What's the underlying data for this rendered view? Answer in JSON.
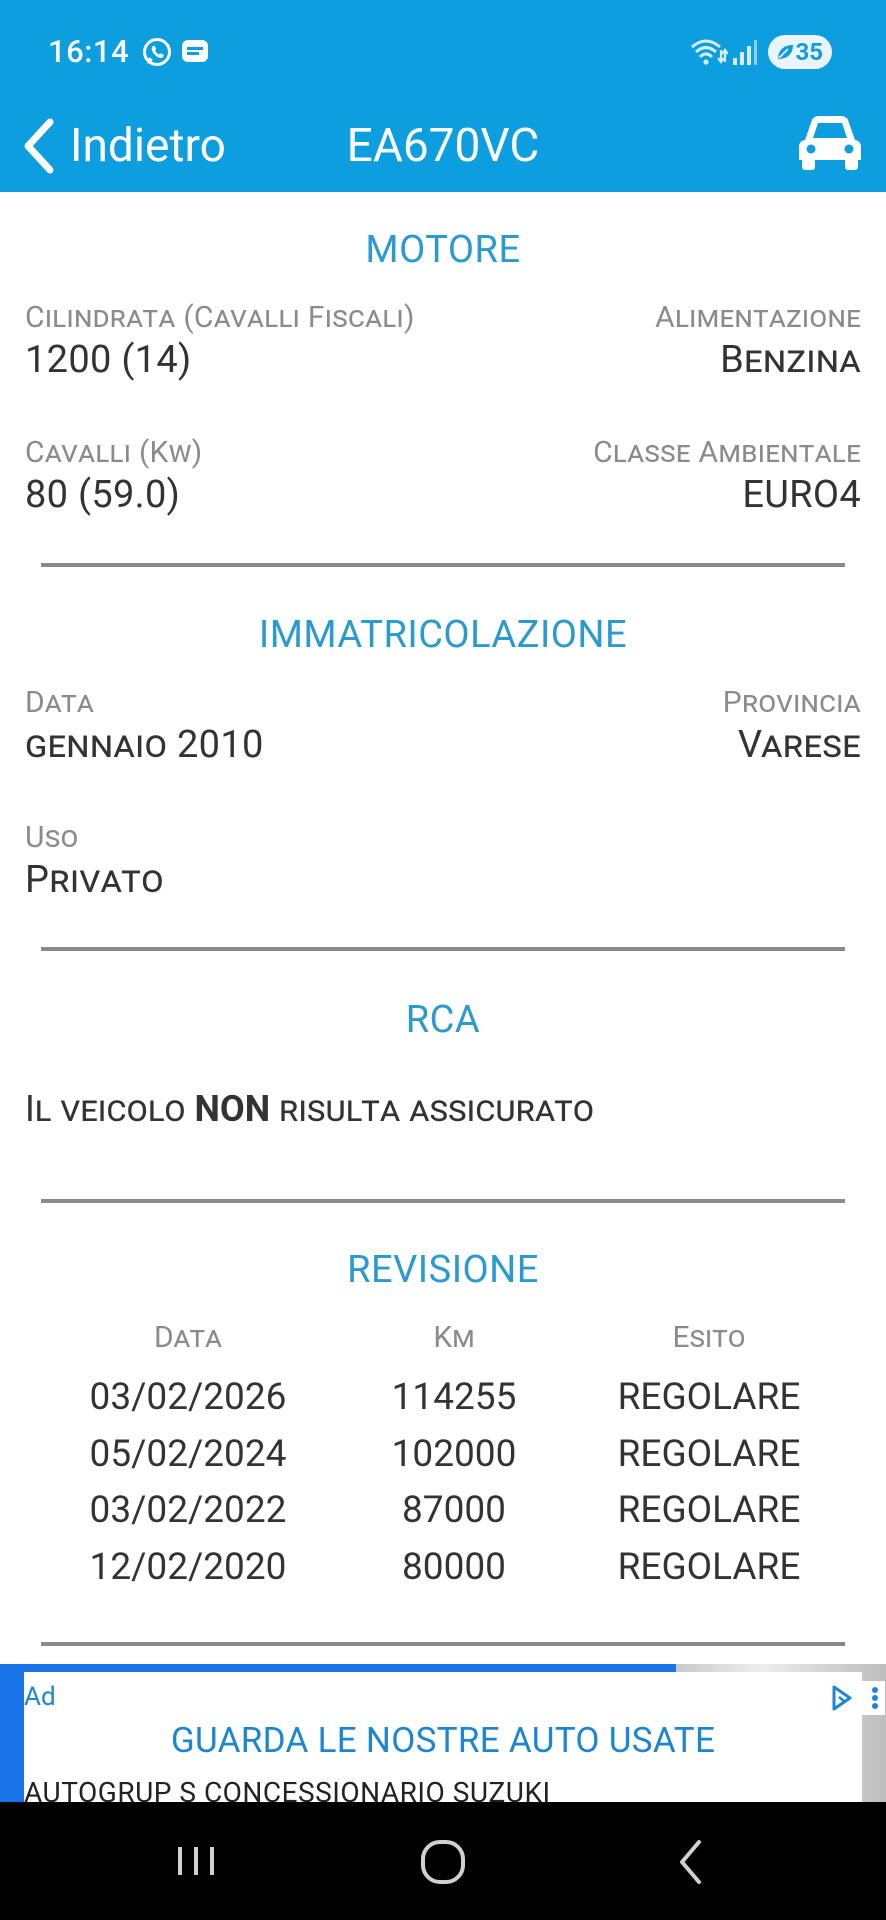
{
  "status_bar": {
    "time": "16:14",
    "battery": "35"
  },
  "header": {
    "back_label": "Indietro",
    "title": "EA670VC"
  },
  "sections": {
    "motore": {
      "title": "MOTORE",
      "cilindrata_label": "Cilindrata (Cavalli Fiscali)",
      "cilindrata_value": "1200 (14)",
      "alimentazione_label": "Alimentazione",
      "alimentazione_value": "Benzina",
      "cavalli_label": "Cavalli (Kw)",
      "cavalli_value": "80 (59.0)",
      "classe_label": "Classe Ambientale",
      "classe_value": "EURO4"
    },
    "immatricolazione": {
      "title": "IMMATRICOLAZIONE",
      "data_label": "Data",
      "data_value": "gennaio 2010",
      "provincia_label": "Provincia",
      "provincia_value": "Varese",
      "uso_label": "Uso",
      "uso_value": "Privato"
    },
    "rca": {
      "title": "RCA",
      "text_before": "Il veicolo ",
      "text_bold": "NON",
      "text_after": " risulta assicurato"
    },
    "revisione": {
      "title": "REVISIONE",
      "headers": [
        "Data",
        "Km",
        "Esito"
      ],
      "rows": [
        [
          "03/02/2026",
          "114255",
          "REGOLARE"
        ],
        [
          "05/02/2024",
          "102000",
          "REGOLARE"
        ],
        [
          "03/02/2022",
          "87000",
          "REGOLARE"
        ],
        [
          "12/02/2020",
          "80000",
          "REGOLARE"
        ]
      ]
    }
  },
  "ad": {
    "label": "Ad",
    "headline": "GUARDA LE NOSTRE AUTO USATE",
    "subtext": "AUTOGRUP S CONCESSIONARIO SUZUKI"
  },
  "colors": {
    "app_bar": "#0d9edf",
    "section_title": "#2b9ad1",
    "divider": "#8a8a8a",
    "ad_accent": "#1a73e8"
  },
  "icons": {
    "back": "chevron-left-icon",
    "car": "car-icon",
    "whatsapp": "whatsapp-icon",
    "message": "message-icon",
    "wifi": "wifi-icon",
    "signal": "signal-icon",
    "battery": "battery-icon",
    "adchoices": "adchoices-icon",
    "nav_recent": "recent-apps-icon",
    "nav_home": "home-icon",
    "nav_back": "back-icon"
  }
}
